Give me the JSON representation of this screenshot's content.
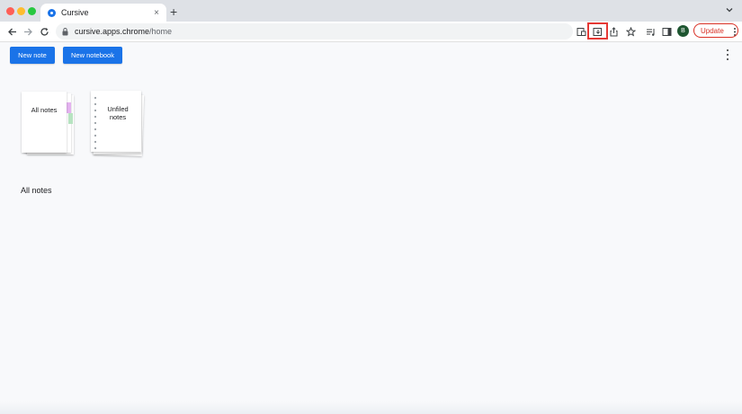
{
  "browser": {
    "tab_title": "Cursive",
    "new_tab_symbol": "+",
    "close_symbol": "×",
    "url_host": "cursive.apps.chrome",
    "url_path": "/home",
    "profile_initial": "B",
    "update_label": "Update",
    "icons": [
      "back-icon",
      "forward-icon",
      "reload-icon",
      "lock-icon",
      "cast-icon",
      "install-app-icon",
      "share-icon",
      "star-icon",
      "reading-list-icon",
      "side-panel-icon",
      "more-vert-icon"
    ],
    "highlight_color": "#e53935"
  },
  "app": {
    "new_note_label": "New note",
    "new_notebook_label": "New notebook",
    "notebooks": [
      {
        "label": "All notes"
      },
      {
        "label": "Unfiled notes"
      }
    ],
    "section_heading": "All notes",
    "accent_color": "#1a73e8"
  }
}
